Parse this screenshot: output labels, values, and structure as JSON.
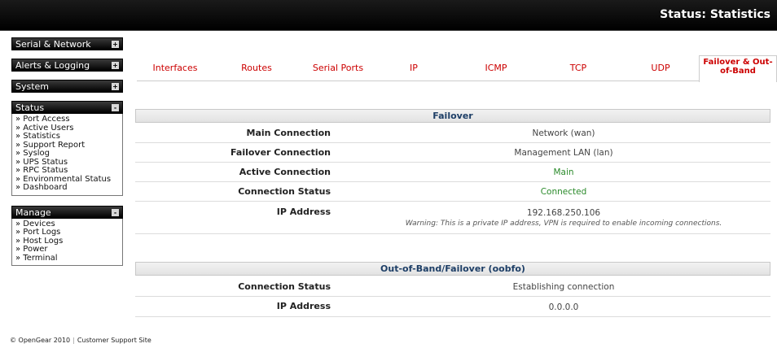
{
  "header": {
    "title": "Status: Statistics"
  },
  "sidebar": {
    "menus": [
      {
        "label": "Serial & Network",
        "toggle": "+"
      },
      {
        "label": "Alerts & Logging",
        "toggle": "+"
      },
      {
        "label": "System",
        "toggle": "+"
      }
    ],
    "status": {
      "label": "Status",
      "toggle": "-",
      "items": [
        "» Port Access",
        "» Active Users",
        "» Statistics",
        "» Support Report",
        "» Syslog",
        "» UPS Status",
        "» RPC Status",
        "» Environmental Status",
        "» Dashboard"
      ]
    },
    "manage": {
      "label": "Manage",
      "toggle": "-",
      "items": [
        "» Devices",
        "» Port Logs",
        "» Host Logs",
        "» Power",
        "» Terminal"
      ]
    }
  },
  "footer": {
    "copyright": "© OpenGear 2010",
    "support": "Customer Support Site"
  },
  "tabs": [
    "Interfaces",
    "Routes",
    "Serial Ports",
    "IP",
    "ICMP",
    "TCP",
    "UDP",
    "Failover & Out-of-Band"
  ],
  "failover": {
    "title": "Failover",
    "rows": [
      {
        "label": "Main Connection",
        "value": "Network (wan)"
      },
      {
        "label": "Failover Connection",
        "value": "Management LAN (lan)"
      },
      {
        "label": "Active Connection",
        "value": "Main"
      },
      {
        "label": "Connection Status",
        "value": "Connected"
      },
      {
        "label": "IP Address",
        "value": "192.168.250.106",
        "warning": "Warning: This is a private IP address, VPN is required to enable incoming connections."
      }
    ]
  },
  "oob": {
    "title": "Out-of-Band/Failover (oobfo)",
    "rows": [
      {
        "label": "Connection Status",
        "value": "Establishing connection"
      },
      {
        "label": "IP Address",
        "value": "0.0.0.0"
      }
    ]
  },
  "colors": {
    "tab_text": "#cc0000",
    "section_title": "#1d3e66",
    "ok_value": "#2a8a2a",
    "topbar": "#000000"
  }
}
